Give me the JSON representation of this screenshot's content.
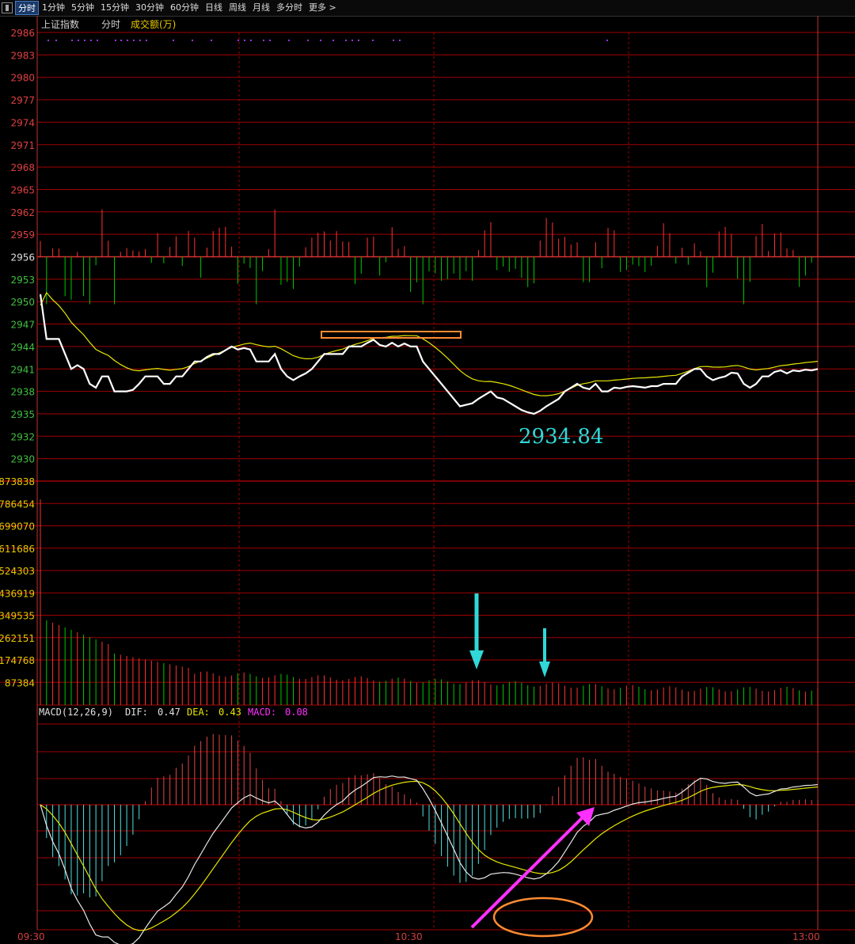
{
  "toolbar": {
    "tabs": [
      "分时",
      "1分钟",
      "5分钟",
      "15分钟",
      "30分钟",
      "60分钟",
      "日线",
      "周线",
      "月线",
      "多分时",
      "更多 >"
    ],
    "active_tab": "分时"
  },
  "header": {
    "index_name": "上证指数",
    "mode": "分时",
    "volume_label": "成交额(万)"
  },
  "price_axis": {
    "ticks": [
      "2986",
      "2983",
      "2980",
      "2977",
      "2974",
      "2971",
      "2968",
      "2965",
      "2962",
      "2959",
      "2956",
      "2953",
      "2950",
      "2947",
      "2944",
      "2941",
      "2938",
      "2935",
      "2932",
      "2930"
    ],
    "prev_close": "2956"
  },
  "volume_axis": {
    "ticks": [
      "873838",
      "786454",
      "699070",
      "611686",
      "524303",
      "436919",
      "349535",
      "262151",
      "174768",
      "87384"
    ]
  },
  "annotation": {
    "low_value": "2934.84"
  },
  "macd": {
    "params": "MACD(12,26,9)",
    "dif_label": "DIF:",
    "dif_value": "0.47",
    "dea_label": "DEA:",
    "dea_value": "0.43",
    "macd_label": "MACD:",
    "macd_value": "0.08"
  },
  "time_axis": {
    "labels": [
      "09:30",
      "10:30",
      "13:00"
    ]
  },
  "colors": {
    "up": "#ff3232",
    "down": "#00c800",
    "price_line": "#ffffff",
    "avg_line": "#e8e800",
    "grid": "#a00000",
    "macd_down": "#50e0e0",
    "arrow_cyan": "#30d8d8",
    "arrow_magenta": "#ff30ff",
    "box_orange": "#ff8c32"
  },
  "chart_data": {
    "type": "line",
    "price": [
      2951,
      2945,
      2945,
      2945,
      2943,
      2941,
      2941.5,
      2941,
      2939,
      2938.5,
      2940,
      2940,
      2938,
      2938,
      2938,
      2938.2,
      2939,
      2940,
      2940,
      2940,
      2939,
      2939,
      2940,
      2940,
      2941,
      2942,
      2942,
      2942.6,
      2943,
      2943,
      2943.5,
      2944,
      2943.6,
      2943.8,
      2943.6,
      2942,
      2942,
      2942,
      2943,
      2941,
      2940,
      2939.5,
      2940,
      2940.4,
      2941,
      2942,
      2943,
      2943,
      2943,
      2943,
      2944,
      2944,
      2944,
      2944.5,
      2944.9,
      2944.2,
      2944,
      2944.5,
      2944,
      2944.4,
      2944,
      2944,
      2942,
      2941,
      2940,
      2939,
      2938,
      2937,
      2936,
      2936.2,
      2936.4,
      2937,
      2937.5,
      2938,
      2937.2,
      2937,
      2936.5,
      2936,
      2935.5,
      2935.2,
      2935,
      2935.4,
      2936,
      2936.5,
      2937,
      2938,
      2938.5,
      2939,
      2938.5,
      2938.3,
      2939,
      2938,
      2938,
      2938.5,
      2938.4,
      2938.6,
      2938.7,
      2938.6,
      2938.5,
      2938.7,
      2938.7,
      2939,
      2939,
      2939,
      2940,
      2940.5,
      2941,
      2941,
      2940,
      2939.5,
      2939.8,
      2940,
      2940.5,
      2940.4,
      2939,
      2938.5,
      2939,
      2940,
      2940,
      2940.6,
      2940.8,
      2940.4,
      2940.8,
      2940.7,
      2940.9,
      2940.8,
      2941
    ]
  }
}
